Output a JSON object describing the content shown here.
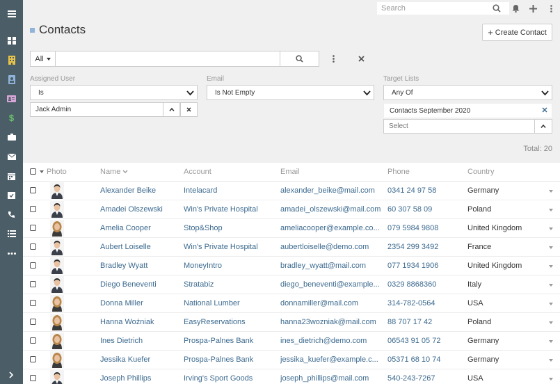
{
  "topbar": {
    "search_placeholder": "Search",
    "icons": [
      "search-icon",
      "bell-icon",
      "plus-icon",
      "kebab-icon"
    ]
  },
  "sidebar": {
    "items": [
      "menu-icon",
      "dashboard-icon",
      "accounts-icon",
      "contacts-icon",
      "leads-icon",
      "opportunities-icon",
      "cases-icon",
      "email-icon",
      "calendar-icon",
      "meetings-icon",
      "calls-icon",
      "tasks-icon",
      "more-icon"
    ],
    "collapse_icon": "chevron-right-icon"
  },
  "page": {
    "title": "Contacts",
    "create_label": "Create Contact"
  },
  "filter": {
    "scope_label": "All",
    "text_value": "",
    "assigned_user": {
      "label": "Assigned User",
      "operator": "Is",
      "value": "Jack Admin"
    },
    "email": {
      "label": "Email",
      "operator": "Is Not Empty"
    },
    "target_lists": {
      "label": "Target Lists",
      "operator": "Any Of",
      "selected": "Contacts September 2020",
      "placeholder": "Select"
    },
    "total": "Total: 20"
  },
  "colors": {
    "sidebar_bg": "#4b5d67",
    "link": "#3c6a8f",
    "accent_square": "#8fb3d9"
  },
  "table": {
    "columns": [
      "Photo",
      "Name",
      "Account",
      "Email",
      "Phone",
      "Country"
    ],
    "rows": [
      {
        "name": "Alexander Beike",
        "account": "Intelacard",
        "email": "alexander_beike@mail.com",
        "phone": "0341 24 97 58",
        "country": "Germany",
        "photo": "male"
      },
      {
        "name": "Amadei Olszewski",
        "account": "Win's Private Hospital",
        "email": "amadei_olszewski@mail.com",
        "phone": "60 307 58 09",
        "country": "Poland",
        "photo": "male"
      },
      {
        "name": "Amelia Cooper",
        "account": "Stop&Shop",
        "email": "ameliacooper@example.co...",
        "phone": "079 5984 9808",
        "country": "United Kingdom",
        "photo": "female"
      },
      {
        "name": "Aubert Loiselle",
        "account": "Win's Private Hospital",
        "email": "aubertloiselle@demo.com",
        "phone": "2354 299 3492",
        "country": "France",
        "photo": "male"
      },
      {
        "name": "Bradley Wyatt",
        "account": "MoneyIntro",
        "email": "bradley_wyatt@mail.com",
        "phone": "077 1934 1906",
        "country": "United Kingdom",
        "photo": "male"
      },
      {
        "name": "Diego Beneventi",
        "account": "Stratabiz",
        "email": "diego_beneventi@example...",
        "phone": "0329 8868360",
        "country": "Italy",
        "photo": "male"
      },
      {
        "name": "Donna Miller",
        "account": "National Lumber",
        "email": "donnamiller@mail.com",
        "phone": "314-782-0564",
        "country": "USA",
        "photo": "female"
      },
      {
        "name": "Hanna Woźniak",
        "account": "EasyReservations",
        "email": "hanna23wozniak@mail.com",
        "phone": "88 707 17 42",
        "country": "Poland",
        "photo": "female"
      },
      {
        "name": "Ines Dietrich",
        "account": "Prospa-Palnes Bank",
        "email": "ines_dietrich@demo.com",
        "phone": "06543 91 05 72",
        "country": "Germany",
        "photo": "female"
      },
      {
        "name": "Jessika Kuefer",
        "account": "Prospa-Palnes Bank",
        "email": "jessika_kuefer@example.c...",
        "phone": "05371 68 10 74",
        "country": "Germany",
        "photo": "female"
      },
      {
        "name": "Joseph Phillips",
        "account": "Irving's Sport Goods",
        "email": "joseph_phillips@mail.com",
        "phone": "540-243-7267",
        "country": "USA",
        "photo": "male"
      }
    ]
  }
}
